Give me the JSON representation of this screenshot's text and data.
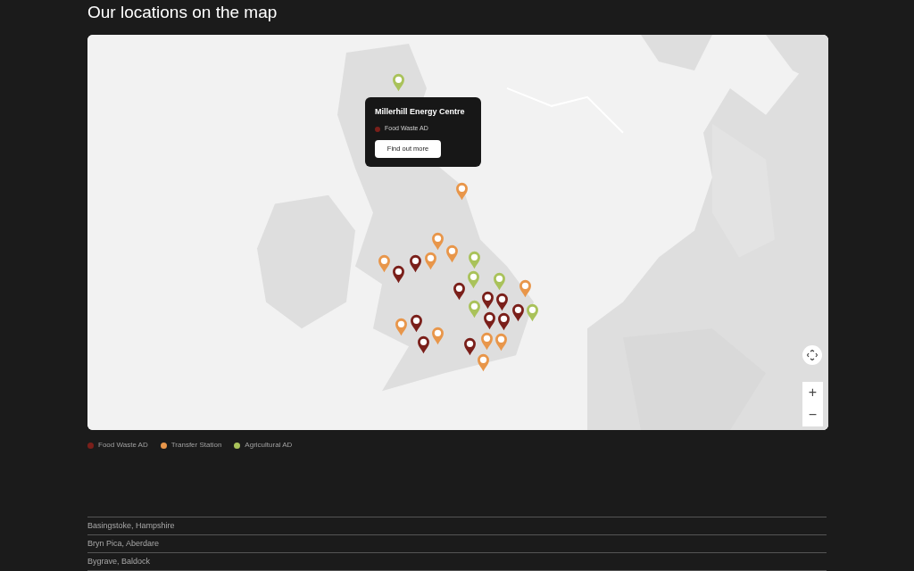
{
  "heading": "Our locations on the map",
  "map": {
    "pins": [
      {
        "color": "#a9c25a"
      },
      {
        "color": "#e8964a"
      },
      {
        "color": "#e8964a"
      },
      {
        "color": "#e8964a"
      },
      {
        "color": "#e8964a"
      },
      {
        "color": "#e8964a"
      },
      {
        "color": "#7a1f1a"
      },
      {
        "color": "#7a1f1a"
      },
      {
        "color": "#a9c25a"
      },
      {
        "color": "#a9c25a"
      },
      {
        "color": "#a9c25a"
      },
      {
        "color": "#e8964a"
      },
      {
        "color": "#7a1f1a"
      },
      {
        "color": "#7a1f1a"
      },
      {
        "color": "#7a1f1a"
      },
      {
        "color": "#7a1f1a"
      },
      {
        "color": "#a9c25a"
      },
      {
        "color": "#7a1f1a"
      },
      {
        "color": "#7a1f1a"
      },
      {
        "color": "#a9c25a"
      },
      {
        "color": "#7a1f1a"
      },
      {
        "color": "#e8964a"
      },
      {
        "color": "#e8964a"
      },
      {
        "color": "#7a1f1a"
      },
      {
        "color": "#e8964a"
      },
      {
        "color": "#e8964a"
      },
      {
        "color": "#7a1f1a"
      },
      {
        "color": "#e8964a"
      }
    ],
    "popup": {
      "title": "Millerhill Energy Centre",
      "category": "Food Waste AD",
      "color": "#7a1f1a",
      "button": "Find out more"
    },
    "zoom_in": "+",
    "zoom_out": "−"
  },
  "legend": [
    {
      "label": "Food Waste AD",
      "color": "#7a1f1a"
    },
    {
      "label": "Transfer Station",
      "color": "#e8964a"
    },
    {
      "label": "Agricultural AD",
      "color": "#a9c25a"
    }
  ],
  "locations": [
    "Basingstoke, Hampshire",
    "Bryn Pica, Aberdare",
    "Bygrave, Baldock"
  ]
}
